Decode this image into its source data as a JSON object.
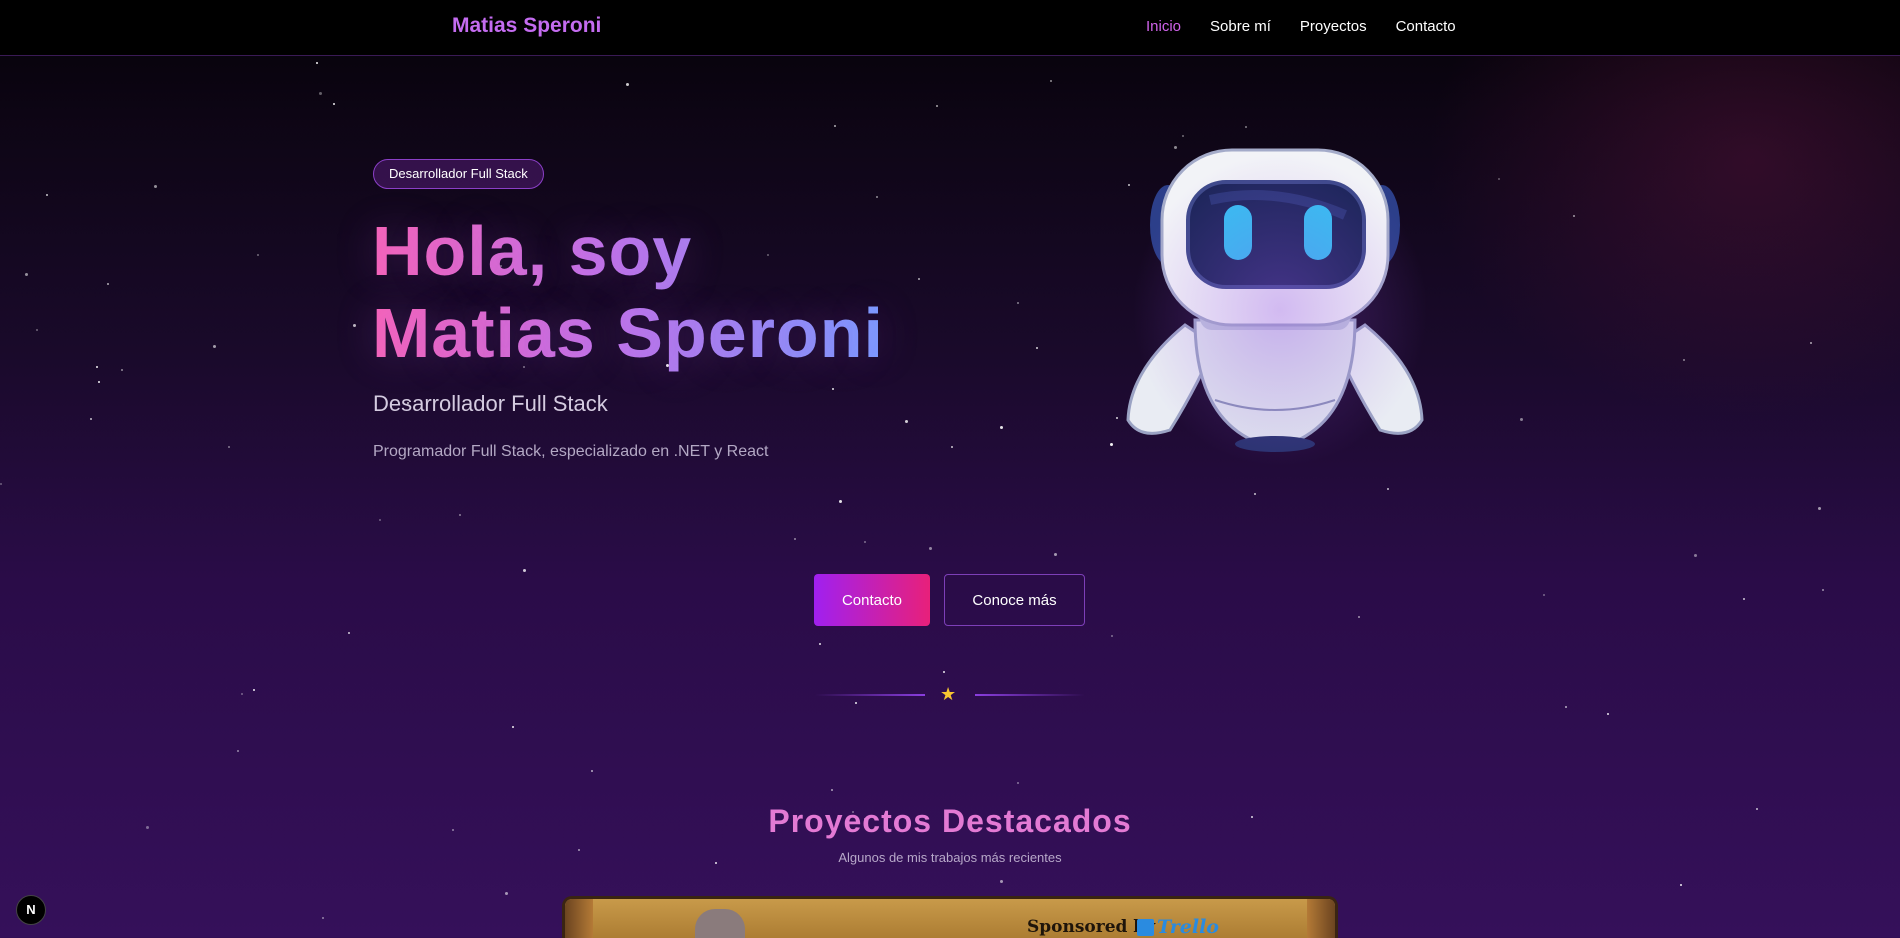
{
  "nav": {
    "brand": "Matias Speroni",
    "links": [
      {
        "label": "Inicio",
        "active": true
      },
      {
        "label": "Sobre mí",
        "active": false
      },
      {
        "label": "Proyectos",
        "active": false
      },
      {
        "label": "Contacto",
        "active": false
      }
    ]
  },
  "hero": {
    "badge": "Desarrollador Full Stack",
    "title_line1": "Hola, soy",
    "title_line2": "Matias Speroni",
    "subtitle": "Desarrollador Full Stack",
    "description": "Programador Full Stack, especializado en .NET y React",
    "buttons": {
      "primary": "Contacto",
      "secondary": "Conoce más"
    },
    "image_icon": "robot-astronaut-icon"
  },
  "divider": {
    "icon": "star-icon"
  },
  "projects": {
    "title": "Proyectos Destacados",
    "subtitle": "Algunos de mis trabajos más recientes",
    "first_card": {
      "sponsor_label": "Sponsored by",
      "sponsor_name": "Trello"
    }
  },
  "framework_badge": "N",
  "colors": {
    "accent": "#c46cf0",
    "active_nav": "#d063ea",
    "primary_button_start": "#a020f0",
    "primary_button_end": "#e8207a",
    "star": "#f7c531"
  }
}
